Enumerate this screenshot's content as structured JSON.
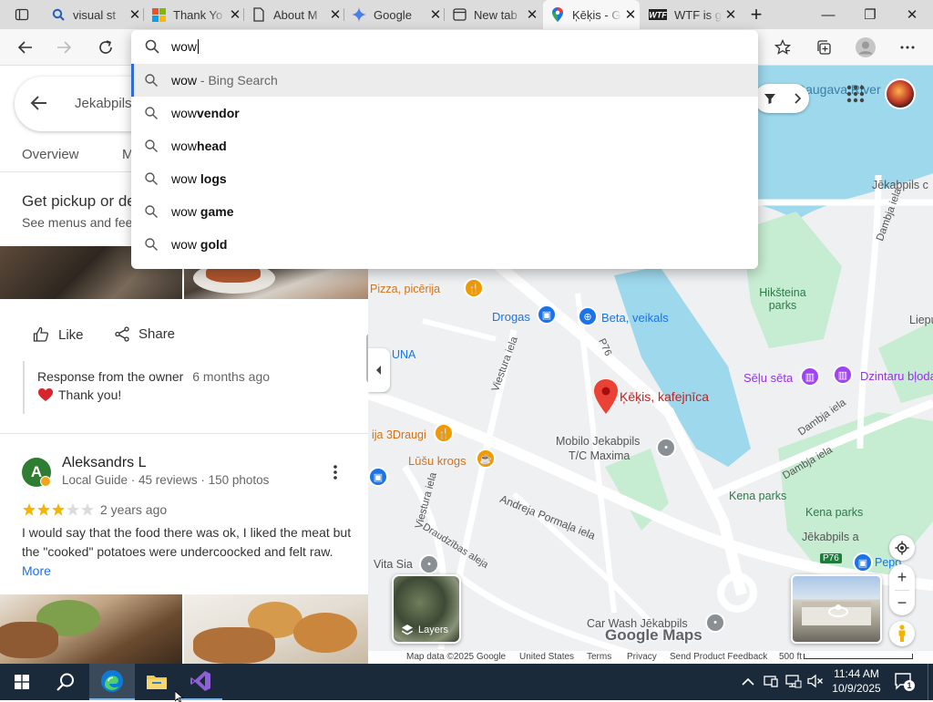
{
  "browser": {
    "tabs": [
      {
        "title": "visual st",
        "icon": "bing-search-icon",
        "close": "✕"
      },
      {
        "title": "Thank Yo",
        "icon": "microsoft-logo-icon",
        "close": "✕"
      },
      {
        "title": "About M",
        "icon": "document-icon",
        "close": "✕"
      },
      {
        "title": "Google",
        "icon": "gemini-icon",
        "close": "✕"
      },
      {
        "title": "New tab",
        "icon": "new-tab-icon",
        "close": "✕"
      },
      {
        "title": "Ķēķis - G",
        "icon": "google-maps-pin-icon",
        "close": "✕",
        "active": true
      },
      {
        "title": "WTF is g",
        "icon": "wtf-icon",
        "close": "✕"
      }
    ],
    "new_tab": "+",
    "window_controls": {
      "minimize": "—",
      "restore": "❐",
      "close": "✕"
    }
  },
  "omnibox": {
    "value": "wow",
    "suggestions": [
      {
        "prefix": "wow",
        "bold": "",
        "suffix": " - Bing Search",
        "selected": true
      },
      {
        "prefix": "wow",
        "bold": "vendor",
        "suffix": ""
      },
      {
        "prefix": "wow",
        "bold": "head",
        "suffix": ""
      },
      {
        "prefix": "wow ",
        "bold": "logs",
        "suffix": ""
      },
      {
        "prefix": "wow ",
        "bold": "game",
        "suffix": ""
      },
      {
        "prefix": "wow ",
        "bold": "gold",
        "suffix": ""
      }
    ]
  },
  "maps_panel": {
    "search_text": "Jekabpils",
    "tabs": [
      "Overview",
      "M"
    ],
    "pickup_title": "Get pickup or de",
    "pickup_sub": "See menus and fee",
    "like_label": "Like",
    "share_label": "Share",
    "owner_response_label": "Response from the owner",
    "owner_response_time": "6 months ago",
    "owner_response_text": "Thank you!",
    "review": {
      "avatar_letter": "A",
      "author": "Aleksandrs L",
      "meta": "Local Guide · 45 reviews · 150 photos",
      "stars": 3,
      "time": "2 years ago",
      "text": "I would say that the food there was ok, I liked the meat but the \"cooked\" potatoes were undercoocked and felt raw.",
      "more": "More"
    }
  },
  "map": {
    "labels": {
      "river": "Daugava River",
      "jekabpils_top": "Jēkabpils c",
      "iela_top": "iela",
      "hiksteina": "Hikšteina parks",
      "liepu": "Liepu i",
      "dambja_top": "Dambja iela",
      "pizza": "Pizza, picērija",
      "drogas": "Drogas",
      "beta": "Beta, veikals",
      "p76": "P76",
      "una": "UNA",
      "viestura": "Viestura iela",
      "selected_place": "Ķēķis, kafejnīca",
      "selu_seta": "Sēļu sēta",
      "dzintaru": "Dzintaru bļoda",
      "draugi": "ija 3Draugi",
      "lusu": "Lūšu krogs",
      "mobilo1": "Mobilo Jekabpils",
      "mobilo2": "T/C Maxima",
      "dambja1": "Dambja iela",
      "dambja2": "Dambja iela",
      "pormala": "Andreja Pormaļa iela",
      "viestura2": "Viestura iela",
      "draudzibas": "Draudzības aleja",
      "kena": "Kena parks",
      "kenap": "Kena parks",
      "vita": "Vita Sia",
      "jekabpils_a": "Jēkabpils a",
      "pepo": "Pepo",
      "p76b": "P76",
      "carwash": "Car Wash Jēkabpils"
    },
    "layers_label": "Layers",
    "logo": "Google Maps",
    "footer": {
      "data": "Map data ©2025 Google",
      "country": "United States",
      "terms": "Terms",
      "privacy": "Privacy",
      "feedback": "Send Product Feedback",
      "scale": "500 ft"
    }
  },
  "taskbar": {
    "time": "11:44 AM",
    "date": "10/9/2025",
    "notification_count": "1"
  }
}
